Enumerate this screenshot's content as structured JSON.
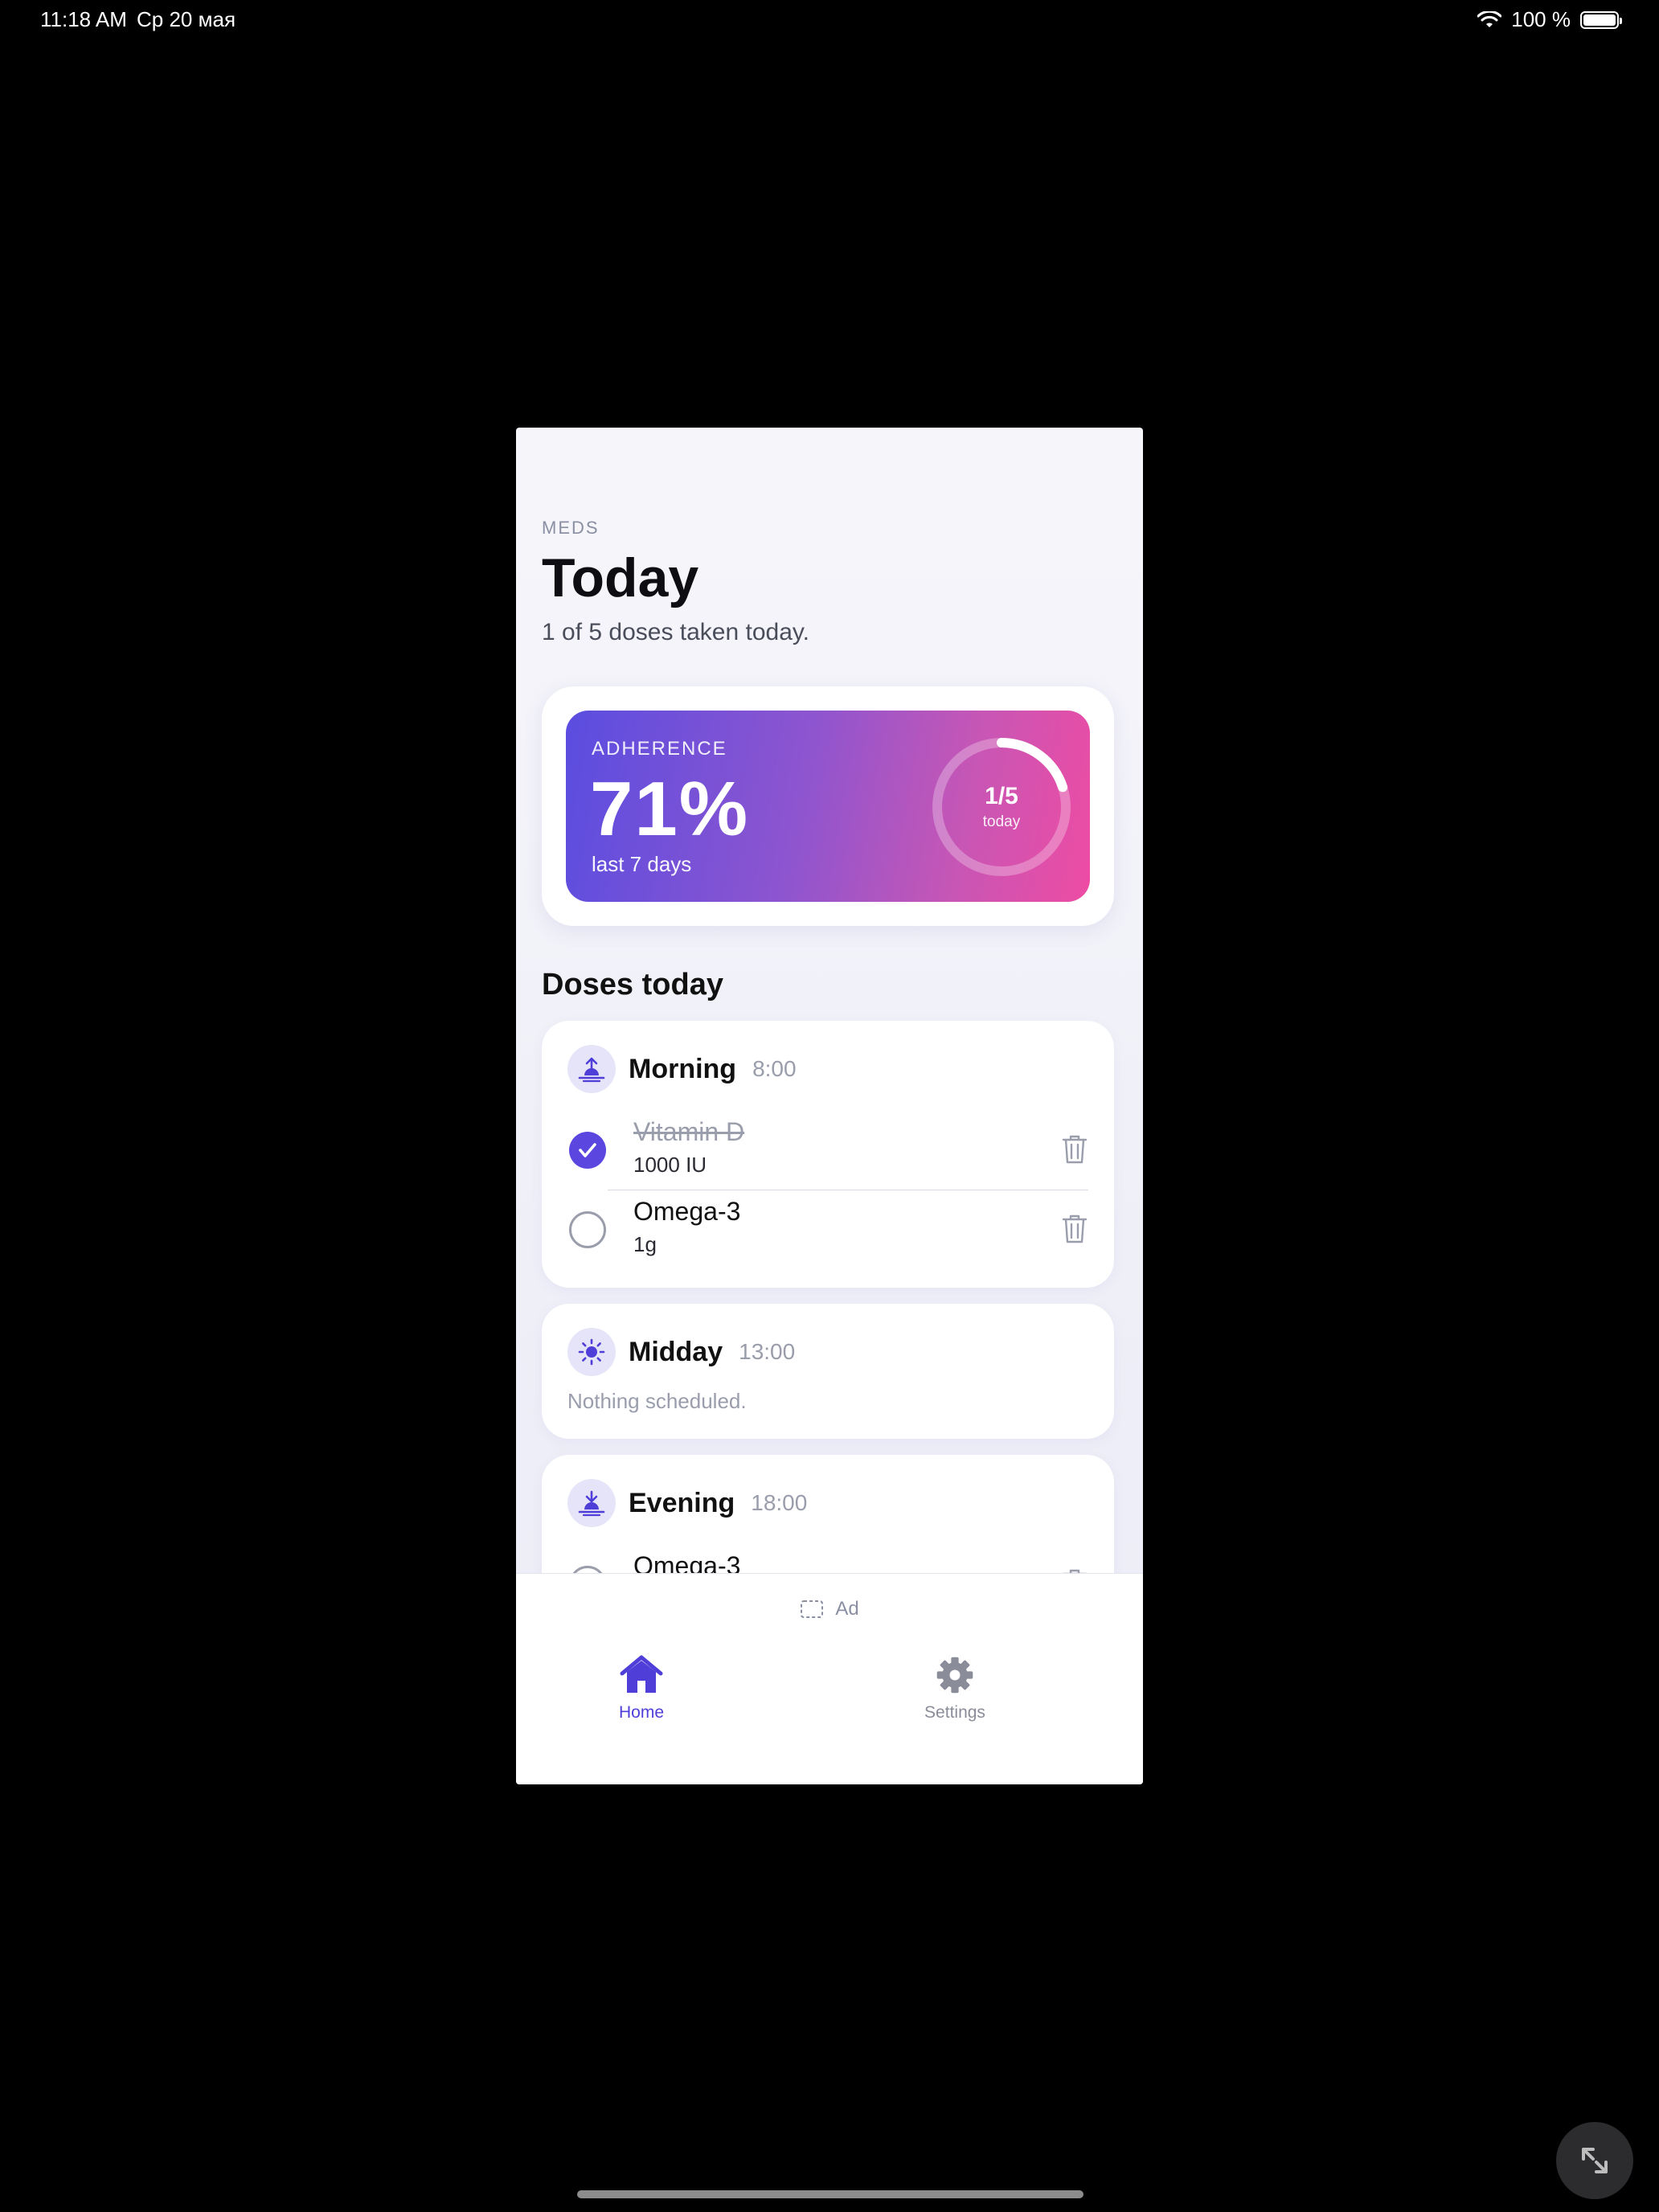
{
  "status_bar": {
    "time": "11:18 AM",
    "date": "Ср 20 мая",
    "battery": "100 %"
  },
  "header": {
    "eyebrow": "MEDS",
    "title": "Today",
    "subtitle": "1 of 5 doses taken today."
  },
  "adherence": {
    "label": "ADHERENCE",
    "value": "71%",
    "period": "last 7 days",
    "ring_fraction": "1/5",
    "ring_sub": "today",
    "ring_progress": 0.2
  },
  "section_title": "Doses today",
  "slots": [
    {
      "name": "Morning",
      "time": "8:00",
      "icon": "sunrise-icon",
      "items": [
        {
          "name": "Vitamin D",
          "dose": "1000 IU",
          "taken": true
        },
        {
          "name": "Omega-3",
          "dose": "1g",
          "taken": false
        }
      ]
    },
    {
      "name": "Midday",
      "time": "13:00",
      "icon": "sun-icon",
      "empty_text": "Nothing scheduled."
    },
    {
      "name": "Evening",
      "time": "18:00",
      "icon": "sunset-icon",
      "items": [
        {
          "name": "Omega-3",
          "taken": false
        }
      ]
    }
  ],
  "ad_label": "Ad",
  "tabs": [
    {
      "label": "Home",
      "icon": "home-icon",
      "active": true
    },
    {
      "label": "Settings",
      "icon": "gear-icon",
      "active": false
    }
  ],
  "colors": {
    "accent": "#5b47e0",
    "gradient_start": "#5a4de0",
    "gradient_end": "#ee4ca3",
    "muted": "#9a9dab"
  }
}
